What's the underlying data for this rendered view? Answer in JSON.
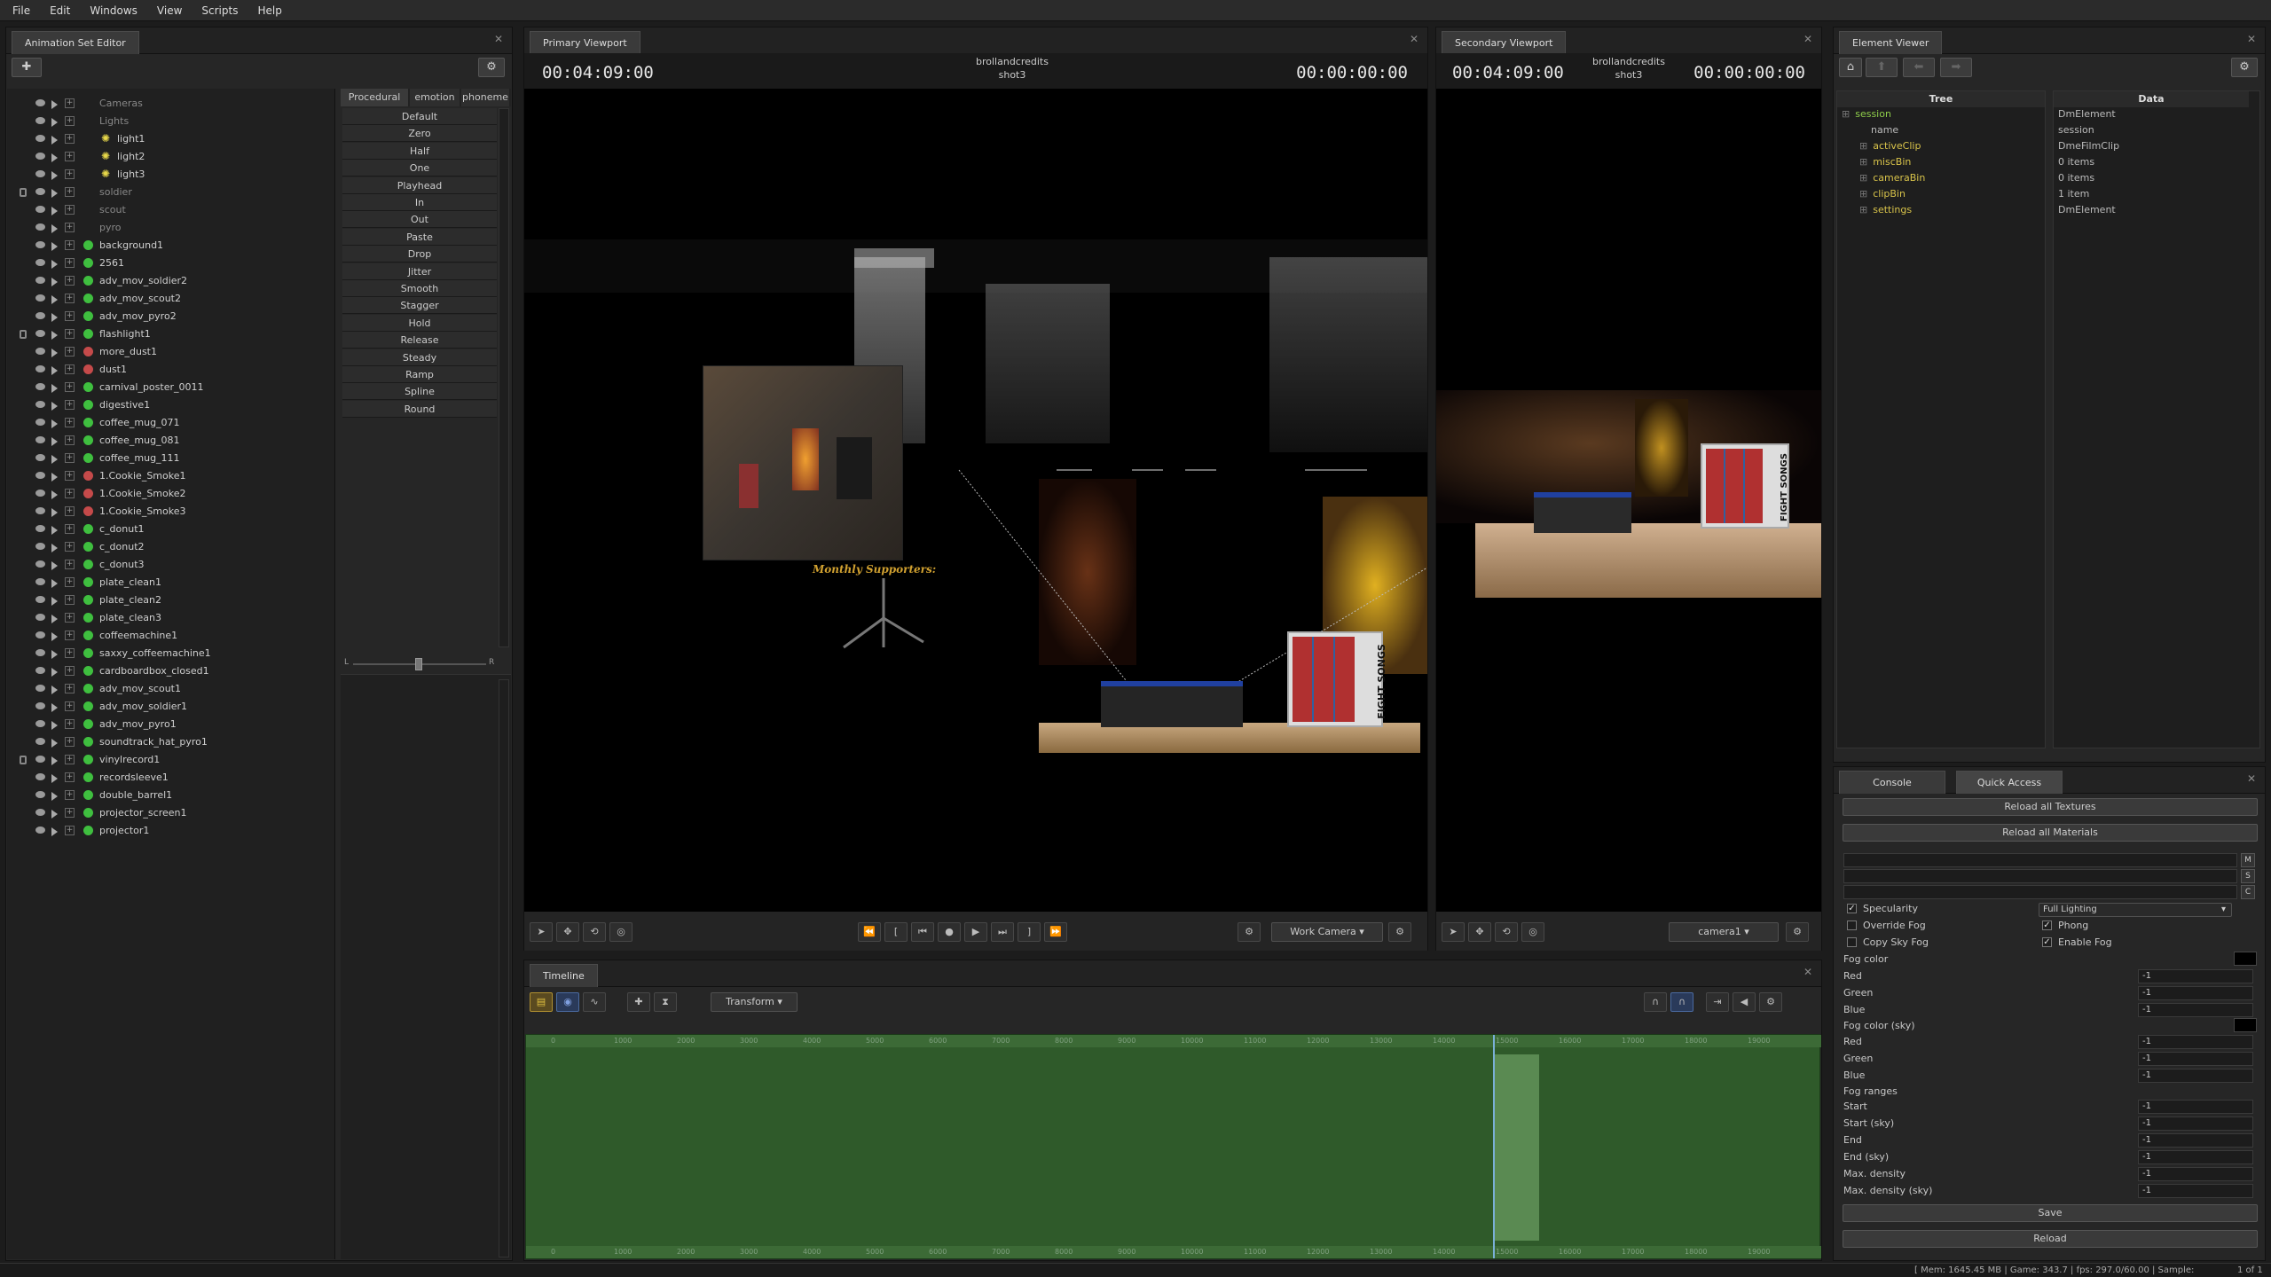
{
  "menubar": {
    "items": [
      "File",
      "Edit",
      "Windows",
      "View",
      "Scripts",
      "Help"
    ]
  },
  "anim_editor": {
    "tab": "Animation Set Editor",
    "preset_tabs": [
      "Procedural",
      "emotion",
      "phoneme"
    ],
    "presets": [
      "Default",
      "Zero",
      "Half",
      "One",
      "Playhead",
      "In",
      "Out",
      "Paste",
      "Drop",
      "Jitter",
      "Smooth",
      "Stagger",
      "Hold",
      "Release",
      "Steady",
      "Ramp",
      "Spline",
      "Round"
    ],
    "slider_left": "L",
    "slider_right": "R",
    "items": [
      {
        "label": "Cameras",
        "kind": "group",
        "locked": false
      },
      {
        "label": "Lights",
        "kind": "group",
        "locked": false
      },
      {
        "label": "light1",
        "kind": "light",
        "locked": false
      },
      {
        "label": "light2",
        "kind": "light",
        "locked": false
      },
      {
        "label": "light3",
        "kind": "light",
        "locked": false
      },
      {
        "label": "soldier",
        "kind": "group",
        "locked": true
      },
      {
        "label": "scout",
        "kind": "group",
        "locked": false
      },
      {
        "label": "pyro",
        "kind": "group",
        "locked": false
      },
      {
        "label": "background1",
        "kind": "model",
        "locked": false
      },
      {
        "label": "2561",
        "kind": "model",
        "locked": false
      },
      {
        "label": "adv_mov_soldier2",
        "kind": "model",
        "locked": false
      },
      {
        "label": "adv_mov_scout2",
        "kind": "model",
        "locked": false
      },
      {
        "label": "adv_mov_pyro2",
        "kind": "model",
        "locked": false
      },
      {
        "label": "flashlight1",
        "kind": "model",
        "locked": true
      },
      {
        "label": "more_dust1",
        "kind": "particle",
        "locked": false
      },
      {
        "label": "dust1",
        "kind": "particle",
        "locked": false
      },
      {
        "label": "carnival_poster_0011",
        "kind": "model",
        "locked": false
      },
      {
        "label": "digestive1",
        "kind": "model",
        "locked": false
      },
      {
        "label": "coffee_mug_071",
        "kind": "model",
        "locked": false
      },
      {
        "label": "coffee_mug_081",
        "kind": "model",
        "locked": false
      },
      {
        "label": "coffee_mug_111",
        "kind": "model",
        "locked": false
      },
      {
        "label": "1.Cookie_Smoke1",
        "kind": "particle",
        "locked": false
      },
      {
        "label": "1.Cookie_Smoke2",
        "kind": "particle",
        "locked": false
      },
      {
        "label": "1.Cookie_Smoke3",
        "kind": "particle",
        "locked": false
      },
      {
        "label": "c_donut1",
        "kind": "model",
        "locked": false
      },
      {
        "label": "c_donut2",
        "kind": "model",
        "locked": false
      },
      {
        "label": "c_donut3",
        "kind": "model",
        "locked": false
      },
      {
        "label": "plate_clean1",
        "kind": "model",
        "locked": false
      },
      {
        "label": "plate_clean2",
        "kind": "model",
        "locked": false
      },
      {
        "label": "plate_clean3",
        "kind": "model",
        "locked": false
      },
      {
        "label": "coffeemachine1",
        "kind": "model",
        "locked": false
      },
      {
        "label": "saxxy_coffeemachine1",
        "kind": "model",
        "locked": false
      },
      {
        "label": "cardboardbox_closed1",
        "kind": "model",
        "locked": false
      },
      {
        "label": "adv_mov_scout1",
        "kind": "model",
        "locked": false
      },
      {
        "label": "adv_mov_soldier1",
        "kind": "model",
        "locked": false
      },
      {
        "label": "adv_mov_pyro1",
        "kind": "model",
        "locked": false
      },
      {
        "label": "soundtrack_hat_pyro1",
        "kind": "model",
        "locked": false
      },
      {
        "label": "vinylrecord1",
        "kind": "model",
        "locked": true
      },
      {
        "label": "recordsleeve1",
        "kind": "model",
        "locked": false
      },
      {
        "label": "double_barrel1",
        "kind": "model",
        "locked": false
      },
      {
        "label": "projector_screen1",
        "kind": "model",
        "locked": false
      },
      {
        "label": "projector1",
        "kind": "model",
        "locked": false
      }
    ]
  },
  "primary_viewport": {
    "tab": "Primary Viewport",
    "time_left": "00:04:09:00",
    "shot_name": "brollandcredits",
    "shot_sub": "shot3",
    "time_right": "00:00:00:00",
    "scene_caption": "Monthly Supporters:",
    "album_text": "FIGHT SONGS",
    "camera_dropdown": "Work Camera"
  },
  "secondary_viewport": {
    "tab": "Secondary Viewport",
    "time_left": "00:04:09:00",
    "shot_name": "brollandcredits",
    "shot_sub": "shot3",
    "time_right": "00:00:00:00",
    "album_text": "FIGHT SONGS",
    "camera_dropdown": "camera1"
  },
  "timeline": {
    "tab": "Timeline",
    "mode_dropdown": "Transform",
    "ticks": [
      "0",
      "1000",
      "2000",
      "3000",
      "4000",
      "5000",
      "6000",
      "7000",
      "8000",
      "9000",
      "10000",
      "11000",
      "12000",
      "13000",
      "14000",
      "15000",
      "16000",
      "17000",
      "18000",
      "19000"
    ],
    "playhead_fraction": 0.75
  },
  "element_viewer": {
    "tab": "Element Viewer",
    "col_tree": "Tree",
    "col_data": "Data",
    "rows": [
      {
        "name": "session",
        "data": "DmElement",
        "color": "#8fce4a",
        "indent": 0
      },
      {
        "name": "name",
        "data": "session",
        "color": "#bbbbbb",
        "indent": 1
      },
      {
        "name": "activeClip",
        "data": "DmeFilmClip",
        "color": "#d8c34a",
        "indent": 1
      },
      {
        "name": "miscBin",
        "data": "0 items",
        "color": "#d8c34a",
        "indent": 1
      },
      {
        "name": "cameraBin",
        "data": "0 items",
        "color": "#d8c34a",
        "indent": 1
      },
      {
        "name": "clipBin",
        "data": "1 item",
        "color": "#d8c34a",
        "indent": 1
      },
      {
        "name": "settings",
        "data": "DmElement",
        "color": "#d8c34a",
        "indent": 1
      }
    ]
  },
  "quick_access": {
    "tabs": [
      "Console",
      "Quick Access"
    ],
    "reload_textures": "Reload all Textures",
    "reload_materials": "Reload all Materials",
    "side_buttons": [
      "M",
      "S",
      "C"
    ],
    "checks": [
      {
        "label": "Specularity",
        "checked": true
      },
      {
        "label": "Override Fog",
        "checked": false
      },
      {
        "label": "Copy Sky Fog",
        "checked": false
      }
    ],
    "lighting_dropdown": "Full Lighting",
    "checks_right": [
      {
        "label": "Phong",
        "checked": true
      },
      {
        "label": "Enable Fog",
        "checked": true
      }
    ],
    "fog_color_label": "Fog color",
    "fog": [
      {
        "label": "Red",
        "value": "-1"
      },
      {
        "label": "Green",
        "value": "-1"
      },
      {
        "label": "Blue",
        "value": "-1"
      }
    ],
    "fog_sky_label": "Fog color (sky)",
    "fog_sky": [
      {
        "label": "Red",
        "value": "-1"
      },
      {
        "label": "Green",
        "value": "-1"
      },
      {
        "label": "Blue",
        "value": "-1"
      }
    ],
    "fog_ranges_label": "Fog ranges",
    "ranges": [
      {
        "label": "Start",
        "value": "-1"
      },
      {
        "label": "Start (sky)",
        "value": "-1"
      },
      {
        "label": "End",
        "value": "-1"
      },
      {
        "label": "End (sky)",
        "value": "-1"
      },
      {
        "label": "Max. density",
        "value": "-1"
      },
      {
        "label": "Max. density (sky)",
        "value": "-1"
      }
    ],
    "save": "Save",
    "reload": "Reload"
  },
  "status_bar": {
    "text": "[ Mem: 1645.45 MB | Game: 343.7 | fps: 297.0/60.00 | Sample:",
    "page": "1 of 1"
  }
}
